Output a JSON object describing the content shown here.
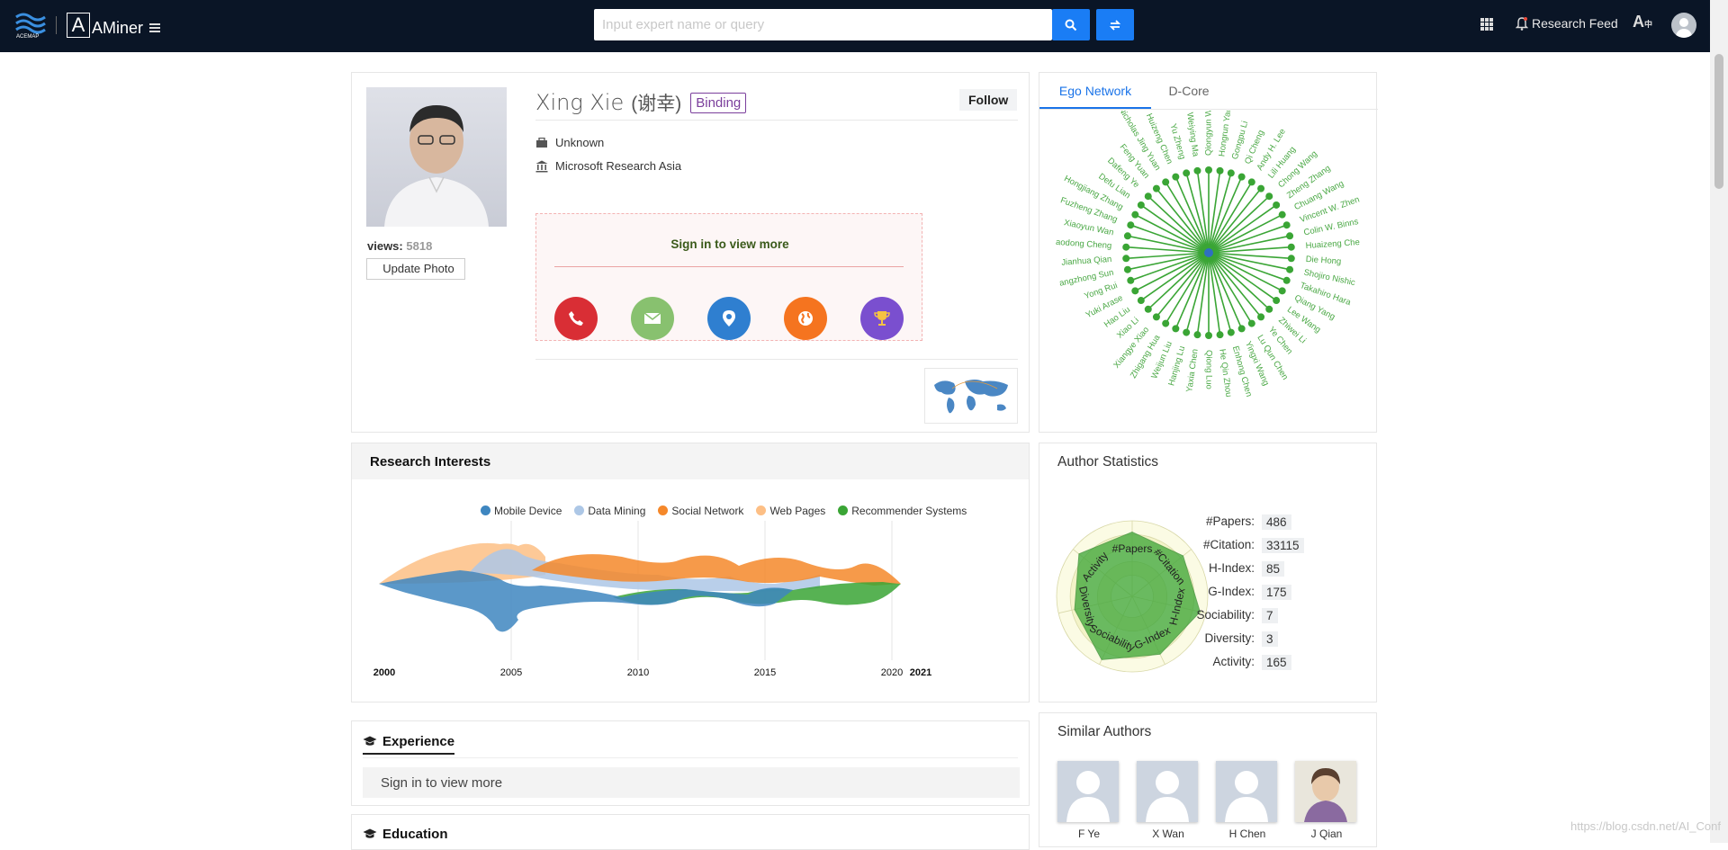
{
  "header": {
    "logo_text": "AMiner",
    "search_placeholder": "Input expert name or query",
    "research_feed_label": "Research Feed"
  },
  "profile": {
    "name": "Xing Xie",
    "name_cn": "(谢幸)",
    "binding_label": "Binding",
    "follow_label": "Follow",
    "position": "Unknown",
    "affiliation": "Microsoft Research Asia",
    "views_label": "views:",
    "views_value": "5818",
    "update_photo_label": "Update Photo",
    "signin_more_label": "Sign in to view more"
  },
  "ego_tabs": {
    "ego_network": "Ego Network",
    "d_core": "D-Core"
  },
  "ego_names": [
    "Qiongyun We",
    "Hongrun Yao",
    "Gongpu Li",
    "Qi Cheng",
    "Andy H. Lee",
    "Lili Huang",
    "Chong Wang",
    "Zheng Zhang",
    "Chuang Wang",
    "Vincent W. Zhen",
    "Colin W. Binns",
    "Huaizeng Che",
    "Die Hong",
    "Shojiro Nishic",
    "Takahiro Hara",
    "Qiang Yang",
    "Lee Wang",
    "Zhiwei Li",
    "Ye Chen",
    "Lu Qun Chen",
    "Yingxi Wang",
    "Enhong Chen",
    "He Qin Zhou",
    "Qiong Luo",
    "Yaxia Chen",
    "Hanjing Lu",
    "Weijun Liu",
    "Zhigang Hua",
    "Xiangye Xiao",
    "Xiao Li",
    "Hao Liu",
    "Yuki Arase",
    "Yong Rui",
    "angzhong Sun",
    "Jianhua Qian",
    "aodong Cheng",
    "Xiaoyun Wan",
    "Fuzheng Zhang",
    "Hongjiang Zhang",
    "Defu Lian",
    "Dafeng Ye",
    "Feng Yuan",
    "Nicholas Jing Yuan",
    "Huizeng Chen",
    "Yu Zheng",
    "Weiying Ma"
  ],
  "research_interests": {
    "title": "Research Interests",
    "chart_data": {
      "type": "area",
      "x": [
        2000,
        2005,
        2010,
        2015,
        2020,
        2021
      ],
      "x_labels": [
        "2000",
        "2005",
        "2010",
        "2015",
        "2020",
        "2021"
      ],
      "series": [
        {
          "name": "Mobile Device",
          "color": "#3e86c0"
        },
        {
          "name": "Data Mining",
          "color": "#adc7e6"
        },
        {
          "name": "Social Network",
          "color": "#f5882a"
        },
        {
          "name": "Web Pages",
          "color": "#fdbf85"
        },
        {
          "name": "Recommender Systems",
          "color": "#3aa535"
        }
      ]
    }
  },
  "author_statistics": {
    "title": "Author Statistics",
    "chart_data": {
      "type": "radar",
      "axes": [
        "#Papers",
        "#Citation",
        "H-Index",
        "G-Index",
        "Sociability",
        "Diversity",
        "Activity"
      ]
    },
    "rows": [
      {
        "key": "#Papers:",
        "value": "486"
      },
      {
        "key": "#Citation:",
        "value": "33115"
      },
      {
        "key": "H-Index:",
        "value": "85"
      },
      {
        "key": "G-Index:",
        "value": "175"
      },
      {
        "key": "Sociability:",
        "value": "7"
      },
      {
        "key": "Diversity:",
        "value": "3"
      },
      {
        "key": "Activity:",
        "value": "165"
      }
    ]
  },
  "experience": {
    "title": "Experience",
    "signin_label": "Sign in to view more"
  },
  "education": {
    "title": "Education"
  },
  "similar_authors": {
    "title": "Similar Authors",
    "items": [
      {
        "name": "F Ye"
      },
      {
        "name": "X Wan"
      },
      {
        "name": "H Chen"
      },
      {
        "name": "J Qian"
      }
    ]
  },
  "watermark": "https://blog.csdn.net/AI_Conf"
}
